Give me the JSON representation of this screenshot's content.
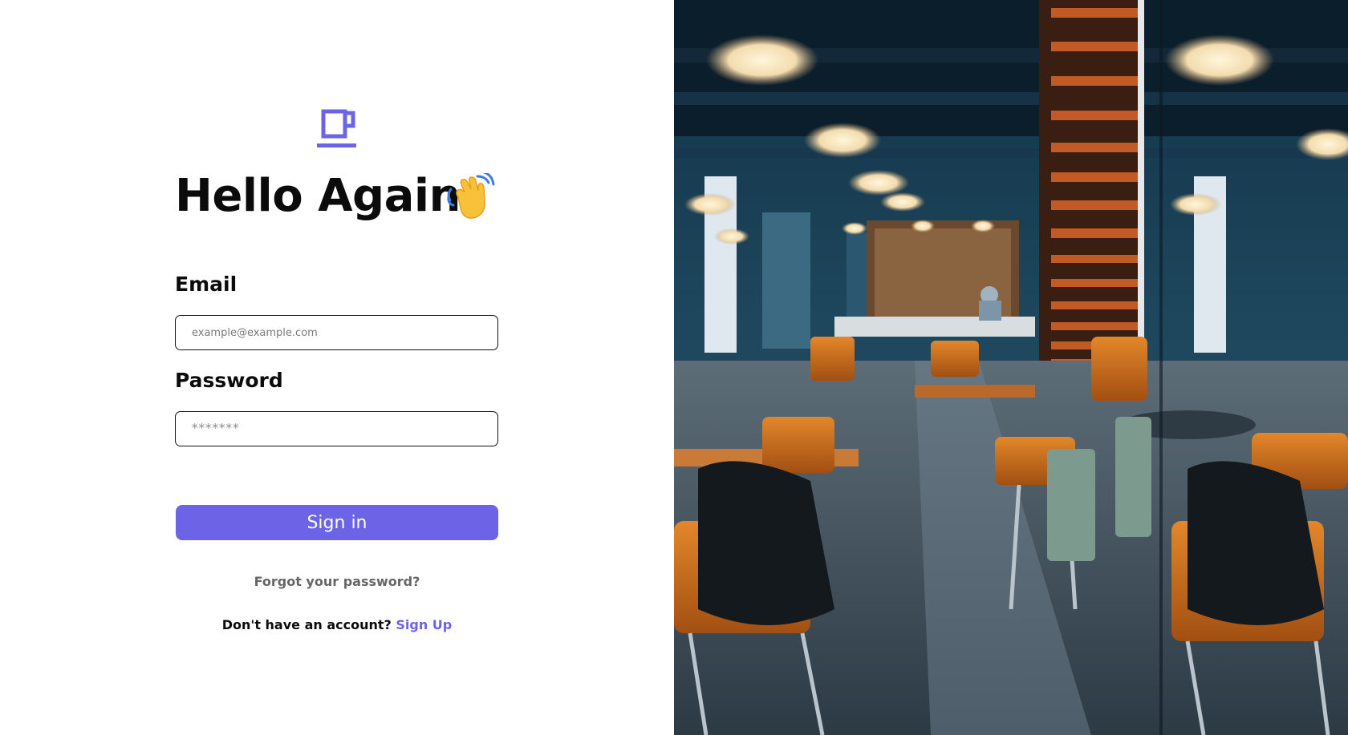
{
  "login": {
    "logo_icon": "coffee-cup-icon",
    "title": "Hello Again",
    "title_icon": "waving-hand-icon",
    "email_label": "Email",
    "email_placeholder": "example@example.com",
    "password_label": "Password",
    "password_placeholder": "*******",
    "signin_label": "Sign in",
    "forgot_label": "Forgot your password?",
    "no_account_text": "Don't have an account?",
    "signup_label": "Sign Up"
  },
  "hero": {
    "image": "cafe-interior-photo"
  },
  "colors": {
    "accent": "#6c63e6",
    "text": "#0b0b0b",
    "muted": "#666666"
  }
}
